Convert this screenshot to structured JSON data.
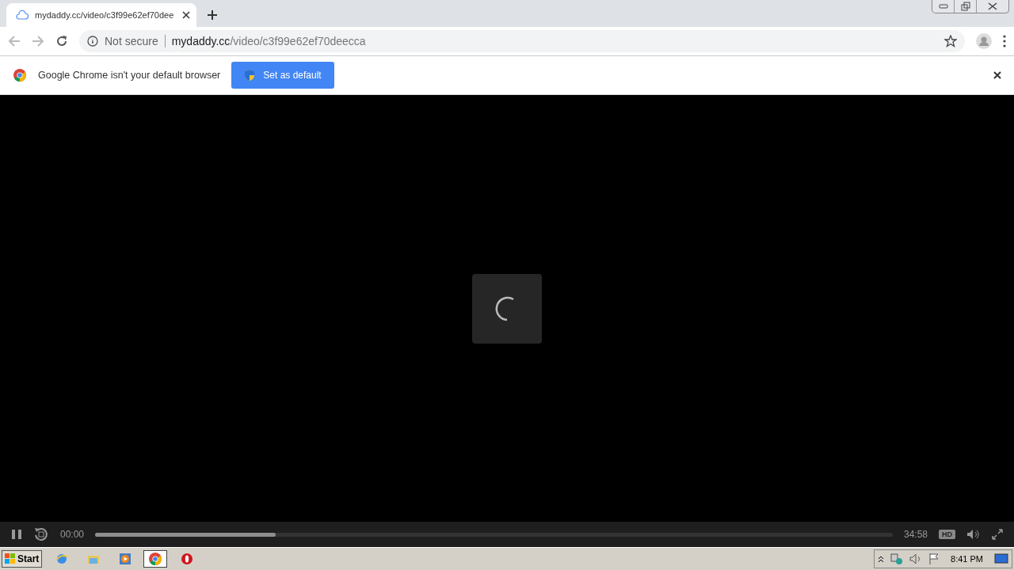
{
  "tab": {
    "title": "mydaddy.cc/video/c3f99e62ef70dee"
  },
  "address_bar": {
    "security": "Not secure",
    "host": "mydaddy.cc",
    "path": "/video/c3f99e62ef70deecca"
  },
  "infobar": {
    "message": "Google Chrome isn't your default browser",
    "button": "Set as default"
  },
  "player": {
    "loading": true,
    "current_time": "00:00",
    "duration": "34:58",
    "quality": "HD",
    "buffer": {
      "level": 0.226
    }
  },
  "taskbar": {
    "start": "Start",
    "apps": [
      {
        "kind": "ie",
        "selected": false
      },
      {
        "kind": "folder",
        "selected": false
      },
      {
        "kind": "media",
        "selected": false
      },
      {
        "kind": "chrome",
        "selected": true
      },
      {
        "kind": "opera",
        "selected": false
      }
    ],
    "clock": "8:41 PM"
  }
}
